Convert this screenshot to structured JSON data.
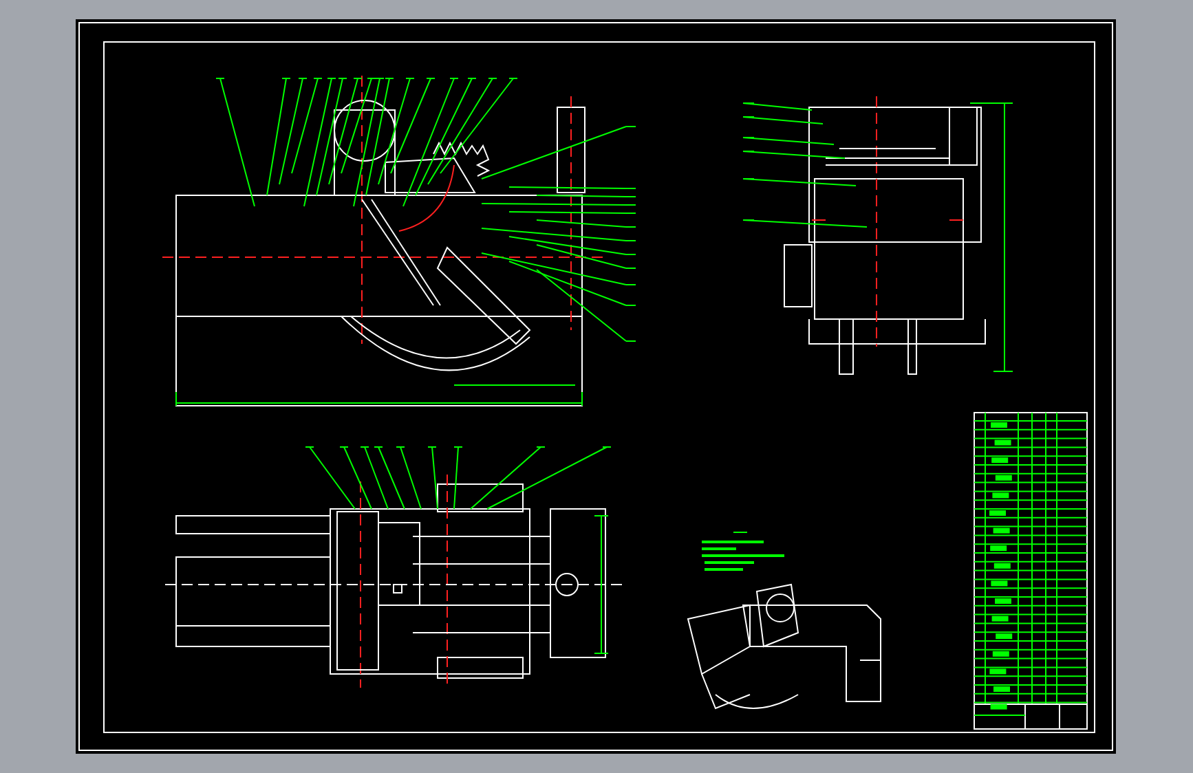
{
  "sheet": {
    "views": [
      {
        "kind": "side-elevation"
      },
      {
        "kind": "end-elevation"
      },
      {
        "kind": "plan"
      },
      {
        "kind": "isometric"
      },
      {
        "kind": "notes"
      },
      {
        "kind": "parts-table"
      }
    ]
  }
}
